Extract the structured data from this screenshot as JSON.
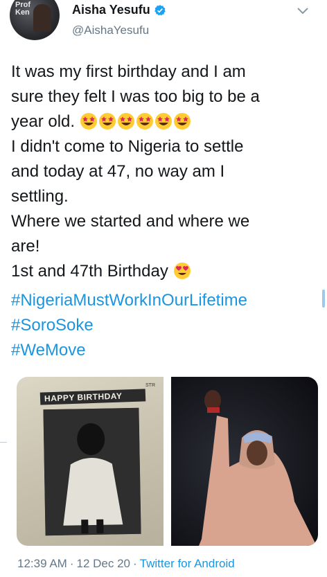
{
  "author": {
    "name": "Aisha Yesufu",
    "handle": "@AishaYesufu",
    "avatar_icon": "profile-avatar",
    "verified_icon": "verified-badge-icon",
    "menu_icon": "chevron-down-icon"
  },
  "tweet": {
    "lines": [
      "It was my first birthday and I am",
      "sure they felt I was too big to be a",
      "year old.",
      "I didn't come to Nigeria to settle",
      "and today at 47, no way am I",
      "settling.",
      "Where we started and where we",
      "are!",
      "1st and 47th Birthday"
    ],
    "emoji_star_struck": "🤩",
    "emoji_heart_eyes": "😍",
    "hashtags": [
      "#NigeriaMustWorkInOurLifetime",
      "#SoroSoke",
      "#WeMove"
    ]
  },
  "media": {
    "left_banner": "HAPPY BIRTHDAY",
    "left_doc_heading": "STR"
  },
  "meta": {
    "time": "12:39 AM",
    "separator": "·",
    "date": "12 Dec 20",
    "source": "Twitter for Android"
  },
  "colors": {
    "link": "#1b95e0",
    "secondary_text": "#657786",
    "verified": "#1da1f2"
  }
}
